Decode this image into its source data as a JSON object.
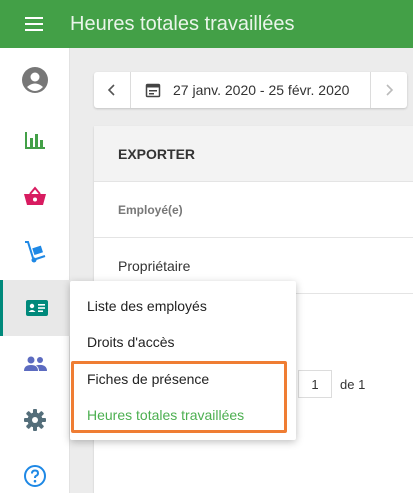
{
  "appbar": {
    "title": "Heures totales travaillées",
    "menu_icon": "hamburger-icon"
  },
  "sidebar": {
    "items": [
      {
        "name": "account",
        "icon": "account-circle-icon",
        "color": "#777777"
      },
      {
        "name": "reports",
        "icon": "bar-chart-icon",
        "color": "#43a047"
      },
      {
        "name": "sales",
        "icon": "basket-icon",
        "color": "#d81b60"
      },
      {
        "name": "inventory",
        "icon": "hand-truck-icon",
        "color": "#1e88e5"
      },
      {
        "name": "employees",
        "icon": "id-card-icon",
        "color": "#00897b",
        "active": true
      },
      {
        "name": "customers",
        "icon": "people-icon",
        "color": "#5c6bc0"
      },
      {
        "name": "settings",
        "icon": "gear-icon",
        "color": "#546e7a"
      },
      {
        "name": "help",
        "icon": "help-icon",
        "color": "#1e88e5"
      }
    ]
  },
  "datebar": {
    "range": "27 janv. 2020 - 25 févr. 2020"
  },
  "card": {
    "header": "EXPORTER",
    "column_header": "Employé(e)",
    "rows": [
      "Propriétaire"
    ]
  },
  "pager": {
    "page": "1",
    "of_text": "de 1"
  },
  "popup_menu": {
    "items": [
      "Liste des employés",
      "Droits d'accès",
      "Fiches de présence",
      "Heures totales travaillées"
    ]
  },
  "colors": {
    "appbar": "#43a047",
    "active_indicator": "#00897b",
    "highlight_border": "#ef7d33",
    "menu_accent": "#4caf50"
  }
}
